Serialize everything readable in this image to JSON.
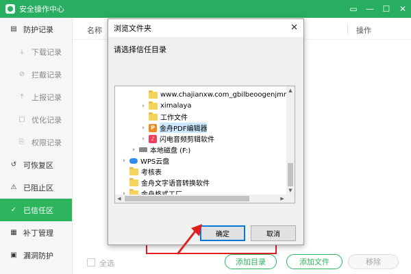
{
  "app": {
    "title": "安全操作中心"
  },
  "window_controls": [
    "feedback-icon",
    "minimize-icon",
    "maximize-icon",
    "close-icon"
  ],
  "sidebar": {
    "items": [
      {
        "label": "防护记录",
        "icon": "shield-list-icon",
        "sub": false,
        "active": false
      },
      {
        "label": "下载记录",
        "icon": "download-icon",
        "sub": true,
        "active": false
      },
      {
        "label": "拦截记录",
        "icon": "block-icon",
        "sub": true,
        "active": false
      },
      {
        "label": "上报记录",
        "icon": "upload-icon",
        "sub": true,
        "active": false
      },
      {
        "label": "优化记录",
        "icon": "optimize-icon",
        "sub": true,
        "active": false
      },
      {
        "label": "权限记录",
        "icon": "permission-icon",
        "sub": true,
        "active": false
      },
      {
        "label": "可恢复区",
        "icon": "restore-icon",
        "sub": false,
        "active": false
      },
      {
        "label": "已阻止区",
        "icon": "blocked-icon",
        "sub": false,
        "active": false
      },
      {
        "label": "已信任区",
        "icon": "trusted-shield-icon",
        "sub": false,
        "active": true
      },
      {
        "label": "补丁管理",
        "icon": "patch-icon",
        "sub": false,
        "active": false
      },
      {
        "label": "漏洞防护",
        "icon": "vulnerability-icon",
        "sub": false,
        "active": false
      }
    ]
  },
  "table": {
    "col_name": "名称",
    "col_op": "操作"
  },
  "footer": {
    "select_all": "全选",
    "add_dir": "添加目录",
    "add_file": "添加文件",
    "remove": "移除"
  },
  "dialog": {
    "title": "浏览文件夹",
    "prompt": "请选择信任目录",
    "ok": "确定",
    "cancel": "取消",
    "tree": [
      {
        "label": "www.chajianxw.com_gbilbeoogenjmnabenk",
        "icon": "folder",
        "arrow": "",
        "indent": 3,
        "selected": false
      },
      {
        "label": "ximalaya",
        "icon": "folder",
        "arrow": "›",
        "indent": 3,
        "selected": false
      },
      {
        "label": "工作文件",
        "icon": "folder",
        "arrow": "",
        "indent": 3,
        "selected": false
      },
      {
        "label": "金舟PDF编辑器",
        "icon": "pdf",
        "arrow": "›",
        "indent": 3,
        "selected": true
      },
      {
        "label": "闪电音频剪辑软件",
        "icon": "audio",
        "arrow": "›",
        "indent": 3,
        "selected": false
      },
      {
        "label": "本地磁盘 (F:)",
        "icon": "drive",
        "arrow": "›",
        "indent": 2,
        "selected": false
      },
      {
        "label": "WPS云盘",
        "icon": "cloud",
        "arrow": "›",
        "indent": 1,
        "selected": false
      },
      {
        "label": "考核表",
        "icon": "folder",
        "arrow": "",
        "indent": 1,
        "selected": false
      },
      {
        "label": "金舟文字语音转换软件",
        "icon": "folder",
        "arrow": "",
        "indent": 1,
        "selected": false
      },
      {
        "label": "金舟格式工厂",
        "icon": "folder",
        "arrow": "›",
        "indent": 1,
        "selected": false
      }
    ]
  },
  "colors": {
    "brand_green": "#2db55d",
    "highlight_red": "#e02020",
    "selection_blue": "#cce8ff"
  }
}
